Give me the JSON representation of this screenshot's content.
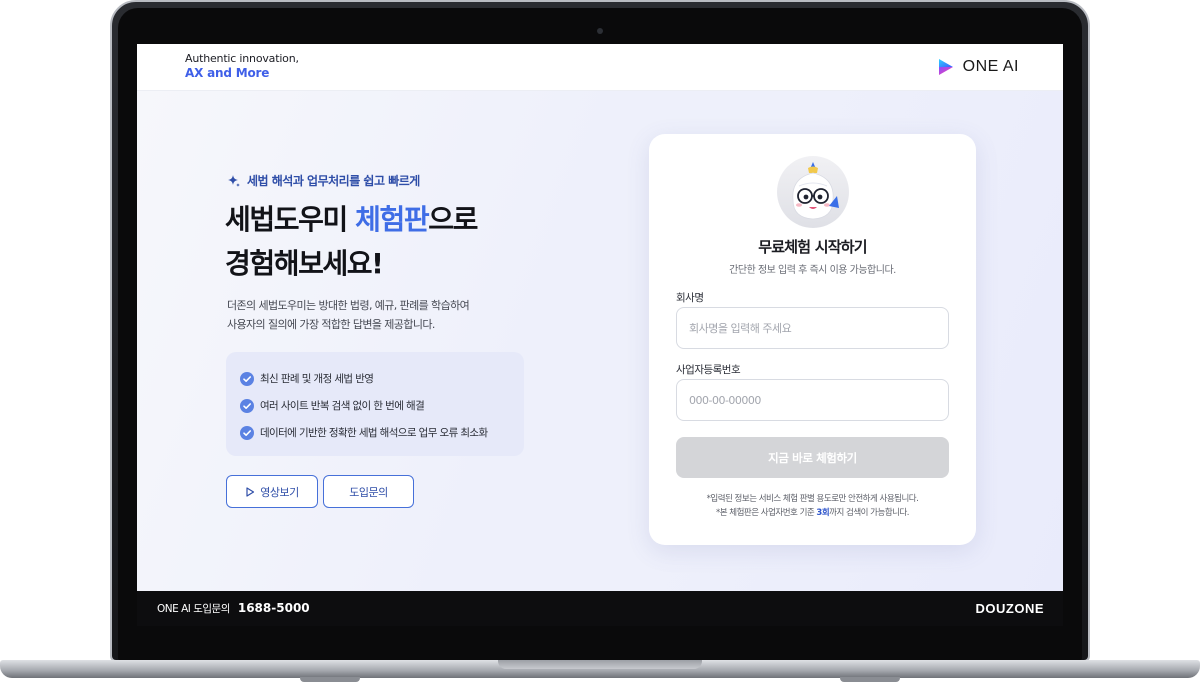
{
  "header": {
    "tagline_line1": "Authentic innovation,",
    "tagline_line2": "AX and More",
    "brand_name": "ONE AI"
  },
  "hero": {
    "eyebrow": "세법 해석과 업무처리를 쉽고 빠르게",
    "headline_part1": "세법도우미 ",
    "headline_highlight": "체험판",
    "headline_part2": "으로",
    "headline_line2": "경험해보세요!",
    "description_line1": "더존의 세법도우미는 방대한 법령, 예규, 판례를 학습하여",
    "description_line2": "사용자의 질의에 가장 적합한 답변을 제공합니다.",
    "features": [
      "최신 판례 및 개정 세법 반영",
      "여러 사이트 반복 검색 없이 한 번에 해결",
      "데이터에 기반한 정확한 세법 해석으로 업무 오류 최소화"
    ],
    "video_button": "영상보기",
    "inquiry_button": "도입문의"
  },
  "card": {
    "title": "무료체험 시작하기",
    "subtitle": "간단한 정보 입력 후 즉시 이용 가능합니다.",
    "company_label": "회사명",
    "company_placeholder": "회사명을 입력해 주세요",
    "company_value": "",
    "bizno_label": "사업자등록번호",
    "bizno_placeholder": "000-00-00000",
    "bizno_value": "",
    "submit_label": "지금 바로 체험하기",
    "note_line1": "*입력된 정보는 서비스 체험 판별 용도로만 안전하게 사용됩니다.",
    "note_line2_prefix": "*본 체험판은 사업자번호 기준 ",
    "note_line2_emphasis": "3회",
    "note_line2_suffix": "까지 검색이 가능합니다."
  },
  "footer": {
    "inquiry_label": "ONE AI 도입문의",
    "phone": "1688-5000",
    "brand": "DOUZONE"
  },
  "colors": {
    "accent": "#3f6de6",
    "button_border": "#4670d9",
    "submit_disabled": "#d4d5d8",
    "footer_bg": "#0d0d0f"
  },
  "icons": {
    "eyebrow": "sparkle-icon",
    "feature": "check-circle-icon",
    "video": "play-icon",
    "brand": "one-ai-logo-icon",
    "avatar": "mascot-avatar"
  }
}
